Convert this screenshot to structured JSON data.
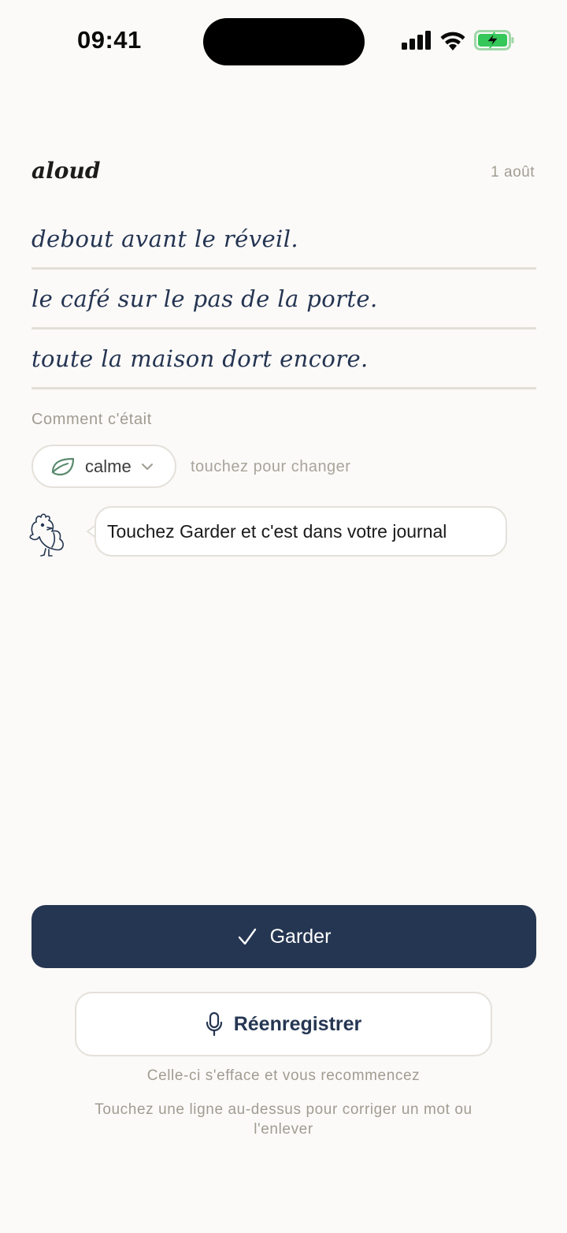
{
  "status_bar": {
    "time": "09:41"
  },
  "header": {
    "app_title": "aloud",
    "date": "1 août"
  },
  "transcript": {
    "lines": [
      "debout avant le réveil.",
      "le café sur le pas de la porte.",
      "toute la maison dort encore."
    ]
  },
  "mood": {
    "label": "Comment c'était",
    "selected": "calme",
    "icon": "leaf-icon",
    "hint": "touchez pour changer"
  },
  "assistant": {
    "icon": "rooster-icon",
    "message": "Touchez Garder et c'est dans votre journal"
  },
  "actions": {
    "keep_label": "Garder",
    "rerecord_label": "Réenregistrer",
    "rerecord_hint": "Celle-ci s'efface et vous recommencez",
    "edit_hint": "Touchez une ligne au-dessus pour corriger un mot ou l'enlever"
  },
  "colors": {
    "background": "#fbfaf8",
    "primary": "#253652",
    "text_muted": "#a09c92",
    "battery_green": "#35c759",
    "leaf_green": "#5a8a6e"
  }
}
